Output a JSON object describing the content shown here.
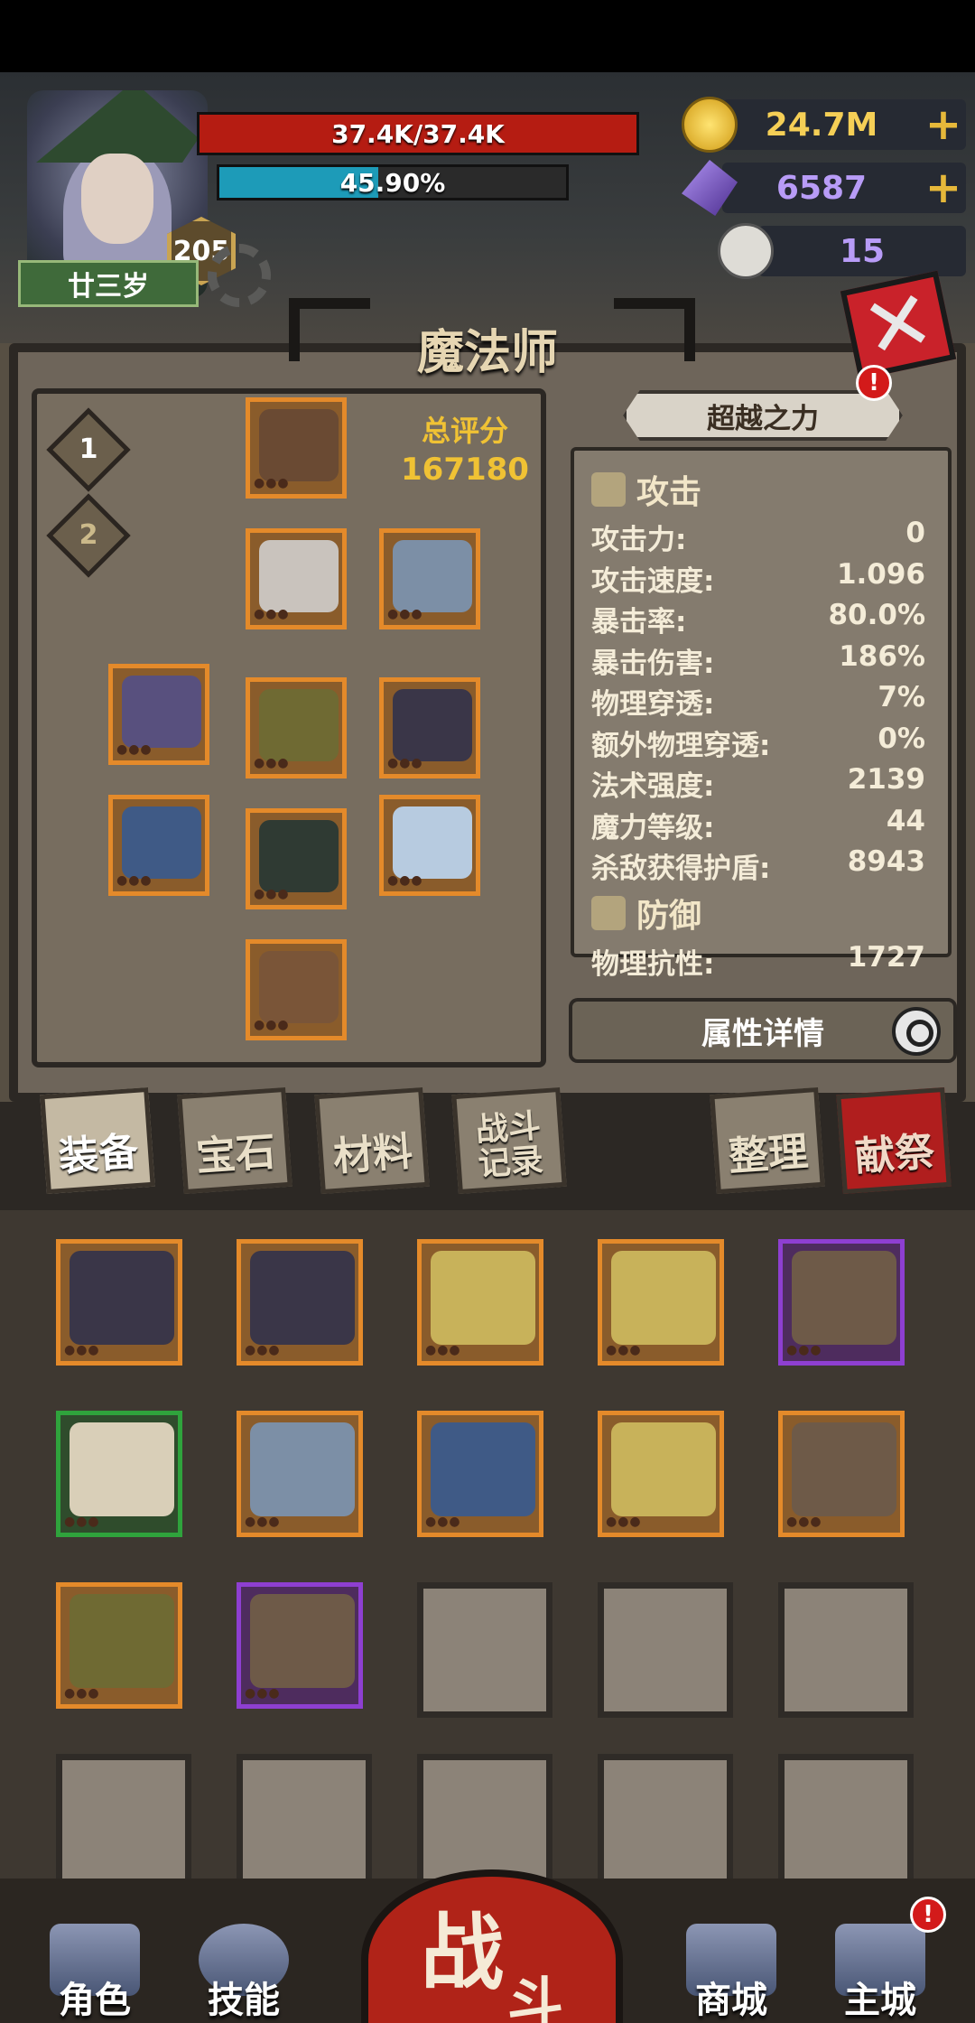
{
  "player": {
    "name": "廿三岁",
    "level": "205",
    "hp_text": "37.4K/37.4K",
    "hp_fraction": 1.0,
    "exp_text": "45.90%",
    "exp_fraction": 0.459
  },
  "currencies": {
    "gold": "24.7M",
    "gems": "6587",
    "skulls": "15"
  },
  "class_title": "魔法师",
  "loadouts": [
    "1",
    "2"
  ],
  "score": {
    "label": "总评分",
    "value": "167180"
  },
  "transcend": {
    "label": "超越之力",
    "alert": "!"
  },
  "stats": {
    "attack_header": "攻击",
    "attack": [
      {
        "label": "攻击力:",
        "value": "0"
      },
      {
        "label": "攻击速度:",
        "value": "1.096"
      },
      {
        "label": "暴击率:",
        "value": "80.0%"
      },
      {
        "label": "暴击伤害:",
        "value": "186%"
      },
      {
        "label": "物理穿透:",
        "value": "7%"
      },
      {
        "label": "额外物理穿透:",
        "value": "0%"
      },
      {
        "label": "法术强度:",
        "value": "2139"
      },
      {
        "label": "魔力等级:",
        "value": "44"
      },
      {
        "label": "杀敌获得护盾:",
        "value": "8943"
      }
    ],
    "defense_header": "防御",
    "defense": [
      {
        "label": "物理抗性:",
        "value": "1727"
      }
    ]
  },
  "detail_button": "属性详情",
  "tabs": {
    "equipment": "装备",
    "gems": "宝石",
    "materials": "材料",
    "battle_log_1": "战斗",
    "battle_log_2": "记录",
    "sort": "整理",
    "sacrifice": "献祭"
  },
  "equipped_slots": [
    {
      "icon": "helmet-icon",
      "rarity": "orange"
    },
    {
      "icon": "robe-icon",
      "rarity": "orange"
    },
    {
      "icon": "cape-icon",
      "rarity": "orange"
    },
    {
      "icon": "orb-icon",
      "rarity": "orange"
    },
    {
      "icon": "belt-icon",
      "rarity": "orange"
    },
    {
      "icon": "amulet-icon",
      "rarity": "orange"
    },
    {
      "icon": "staff-icon",
      "rarity": "orange"
    },
    {
      "icon": "pants-icon",
      "rarity": "orange"
    },
    {
      "icon": "glove-icon",
      "rarity": "orange"
    },
    {
      "icon": "boots-icon",
      "rarity": "orange"
    }
  ],
  "bag_items": [
    {
      "icon": "amulet-icon",
      "rarity": "orange"
    },
    {
      "icon": "amulet-icon",
      "rarity": "orange"
    },
    {
      "icon": "ring-icon",
      "rarity": "orange"
    },
    {
      "icon": "ring-icon",
      "rarity": "orange"
    },
    {
      "icon": "mace-icon",
      "rarity": "purple"
    },
    {
      "icon": "candle-icon",
      "rarity": "green"
    },
    {
      "icon": "cape-icon",
      "rarity": "orange"
    },
    {
      "icon": "staff-icon",
      "rarity": "orange"
    },
    {
      "icon": "ring-icon",
      "rarity": "orange"
    },
    {
      "icon": "mace-icon",
      "rarity": "orange"
    },
    {
      "icon": "belt-icon",
      "rarity": "orange"
    },
    {
      "icon": "mace-icon",
      "rarity": "purple"
    },
    {
      "icon": "",
      "rarity": "empty"
    },
    {
      "icon": "",
      "rarity": "empty"
    },
    {
      "icon": "",
      "rarity": "empty"
    },
    {
      "icon": "",
      "rarity": "empty"
    },
    {
      "icon": "",
      "rarity": "empty"
    },
    {
      "icon": "",
      "rarity": "empty"
    },
    {
      "icon": "",
      "rarity": "empty"
    },
    {
      "icon": "",
      "rarity": "empty"
    }
  ],
  "nav": {
    "character": "角色",
    "skills": "技能",
    "battle_1": "战",
    "battle_2": "斗",
    "shop": "商城",
    "main_city": "主城",
    "main_city_alert": "!"
  },
  "colors": {
    "hp": "#b51c12",
    "exp": "#1d9bb8",
    "gold": "#f0c234",
    "rarity_orange": "#e48a2a",
    "rarity_purple": "#8e3fd1",
    "rarity_green": "#2fa33c"
  }
}
